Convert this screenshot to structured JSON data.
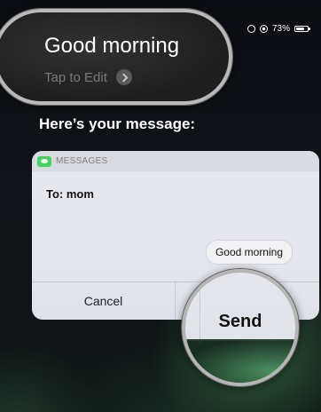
{
  "status_bar": {
    "battery_percent": "73%",
    "icons": [
      "orientation-lock-icon",
      "alarm-icon",
      "battery-icon"
    ]
  },
  "siri": {
    "utterance": "Good morning",
    "tap_to_edit": "Tap to Edit",
    "heading": "Here’s your message:"
  },
  "card": {
    "app_name": "MESSAGES",
    "recipient": "To: mom",
    "message_text": "Good morning",
    "cancel_label": "Cancel",
    "send_label": "Send"
  },
  "colors": {
    "messages_green": "#44d35c",
    "lens_ring": "#b9b9b9"
  }
}
